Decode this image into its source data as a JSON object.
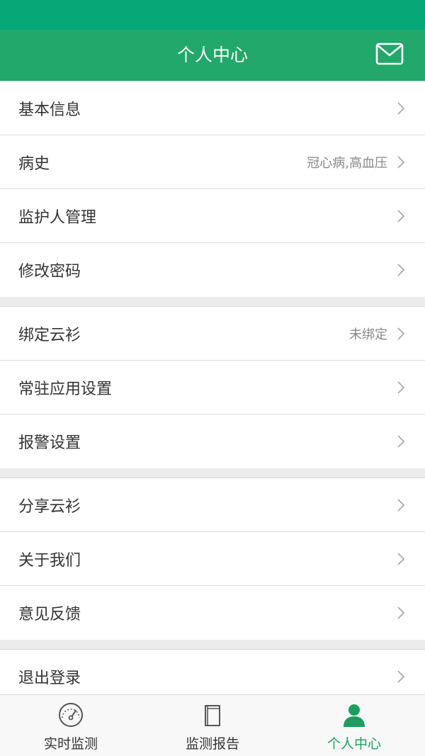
{
  "header": {
    "title": "个人中心",
    "action_icon": "mail-icon"
  },
  "menu": {
    "groups": [
      {
        "items": [
          {
            "label": "基本信息",
            "value": ""
          },
          {
            "label": "病史",
            "value": "冠心病,高血压"
          },
          {
            "label": "监护人管理",
            "value": ""
          },
          {
            "label": "修改密码",
            "value": ""
          }
        ]
      },
      {
        "items": [
          {
            "label": "绑定云衫",
            "value": "未绑定"
          },
          {
            "label": "常驻应用设置",
            "value": ""
          },
          {
            "label": "报警设置",
            "value": ""
          }
        ]
      },
      {
        "items": [
          {
            "label": "分享云衫",
            "value": ""
          },
          {
            "label": "关于我们",
            "value": ""
          },
          {
            "label": "意见反馈",
            "value": ""
          }
        ]
      },
      {
        "items": [
          {
            "label": "退出登录",
            "value": ""
          }
        ]
      }
    ]
  },
  "tabbar": {
    "tabs": [
      {
        "label": "实时监测",
        "icon": "speedometer-icon",
        "active": false
      },
      {
        "label": "监测报告",
        "icon": "book-icon",
        "active": false
      },
      {
        "label": "个人中心",
        "icon": "person-icon",
        "active": true
      }
    ]
  },
  "colors": {
    "status_bar": "#05a876",
    "app_bar": "#22a86a",
    "active_tab": "#1d9e5f",
    "text_primary": "#333333",
    "text_secondary": "#888888",
    "background": "#ececec"
  }
}
